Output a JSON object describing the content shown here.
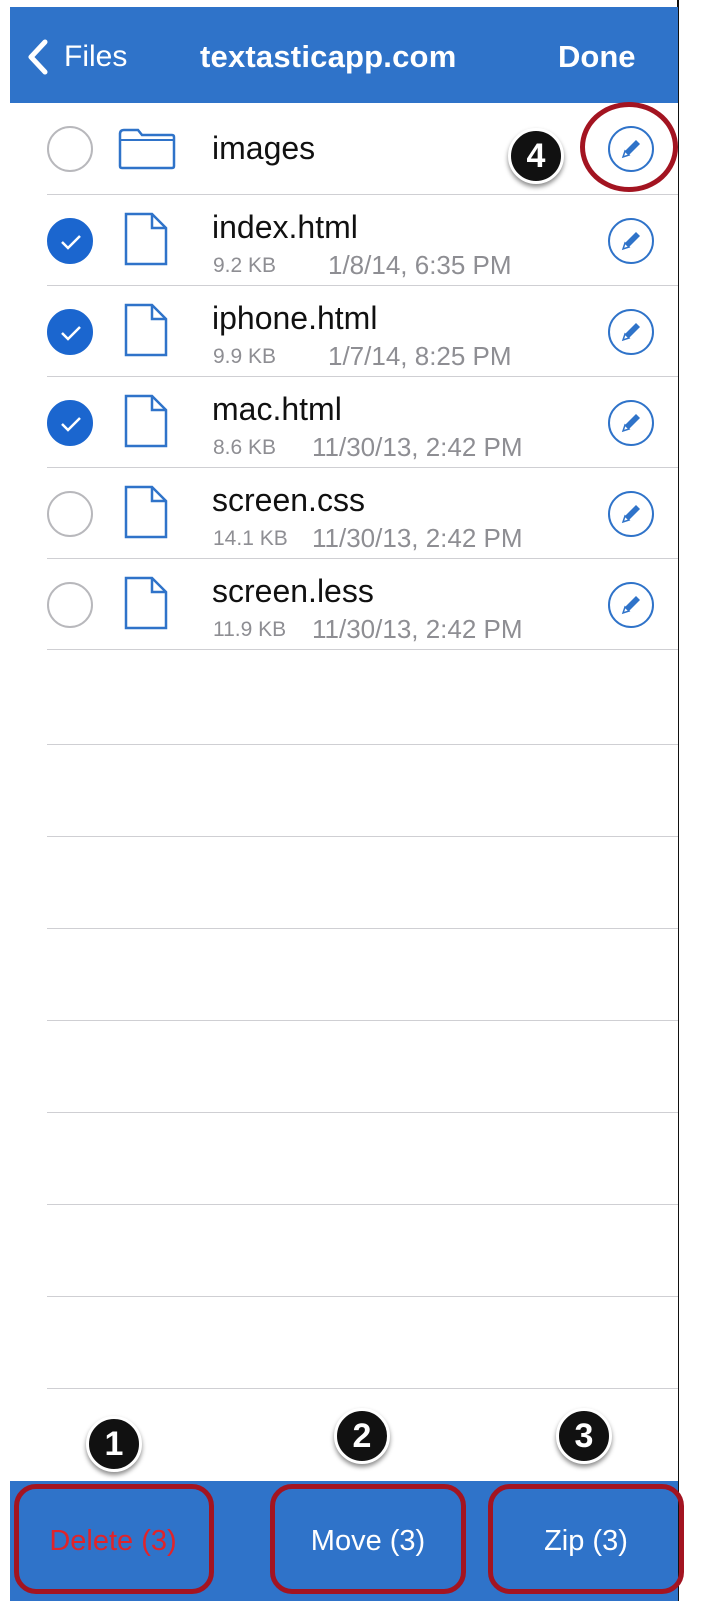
{
  "nav": {
    "back_label": "Files",
    "title": "textasticapp.com",
    "done_label": "Done"
  },
  "rows": [
    {
      "type": "folder",
      "name": "images",
      "selected": false
    },
    {
      "type": "file",
      "name": "index.html",
      "size": "9.2 KB",
      "date": "1/8/14, 6:35 PM",
      "selected": true
    },
    {
      "type": "file",
      "name": "iphone.html",
      "size": "9.9 KB",
      "date": "1/7/14, 8:25 PM",
      "selected": true
    },
    {
      "type": "file",
      "name": "mac.html",
      "size": "8.6 KB",
      "date": "11/30/13, 2:42 PM",
      "selected": true
    },
    {
      "type": "file",
      "name": "screen.css",
      "size": "14.1 KB",
      "date": "11/30/13, 2:42 PM",
      "selected": false
    },
    {
      "type": "file",
      "name": "screen.less",
      "size": "11.9 KB",
      "date": "11/30/13, 2:42 PM",
      "selected": false
    }
  ],
  "toolbar": {
    "delete_label": "Delete (3)",
    "move_label": "Move (3)",
    "zip_label": "Zip (3)"
  },
  "annotations": {
    "badge_1": "1",
    "badge_2": "2",
    "badge_3": "3",
    "badge_4": "4"
  },
  "colors": {
    "accent": "#2f73c9",
    "checked": "#1b66cf",
    "delete": "#e0242a",
    "annotation_ring": "#a31421"
  },
  "icons": {
    "back": "chevron-left-icon",
    "folder": "folder-icon",
    "file": "file-icon",
    "checked": "checkmark-icon",
    "edit": "pencil-icon"
  }
}
